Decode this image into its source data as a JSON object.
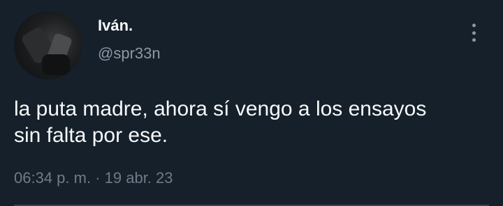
{
  "author": {
    "display_name": "Iván.",
    "handle": "@spr33n",
    "avatar_icon": "profile-photo"
  },
  "tweet": {
    "text": "la puta madre, ahora sí vengo a los ensayos\nsin falta por ese.",
    "time": "06:34 p. m.",
    "separator": " · ",
    "date": "19 abr. 23"
  },
  "menu": {
    "icon": "more-vertical-icon"
  },
  "colors": {
    "background": "#15202b",
    "text_primary": "#f7f9f9",
    "text_secondary": "#8b98a5",
    "divider": "#38444d"
  }
}
